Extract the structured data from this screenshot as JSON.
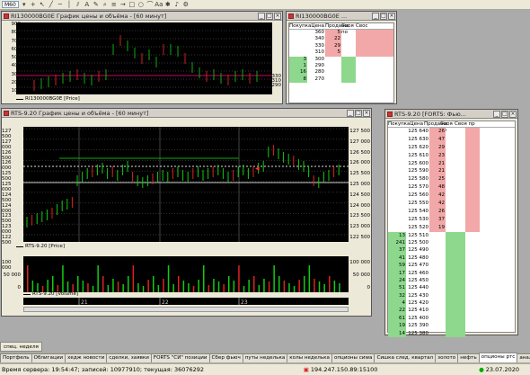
{
  "toolbar": {
    "timeframe": "M60"
  },
  "win1": {
    "title": "RI130000BG0E График цены и объёма - [60 минут]",
    "y_labels": [
      "900",
      "800",
      "700",
      "600",
      "500",
      "400",
      "300",
      "200",
      "100"
    ],
    "r_labels": [
      "330",
      "310",
      "290"
    ],
    "legend": "RI130000BG0E [Price]"
  },
  "win2": {
    "title": "RI130000BG0E ...",
    "headers": [
      "Покупка",
      "Цена",
      "Продажа",
      "Своя по",
      "Свос"
    ],
    "sells": [
      [
        "",
        "360",
        "5"
      ],
      [
        "",
        "340",
        "22"
      ],
      [
        "",
        "330",
        "29"
      ],
      [
        "",
        "310",
        "5"
      ]
    ],
    "buys": [
      [
        "3",
        "300",
        ""
      ],
      [
        "1",
        "290",
        ""
      ],
      [
        "16",
        "280",
        ""
      ],
      [
        "8",
        "270",
        ""
      ]
    ]
  },
  "win3": {
    "title": "RTS-9.20 График цены и объёма - [60 минут]",
    "price_labels": [
      "127 500",
      "127 000",
      "126 500",
      "126 000",
      "125 500",
      "125 000",
      "124 500",
      "124 000",
      "123 500",
      "123 000",
      "122 500"
    ],
    "cur_price": "125 630",
    "legend1": "RTS-9.20 [Price]",
    "vol_labels": [
      "100 000",
      "50 000",
      "0"
    ],
    "legend2": "RTS-9.20 [Volume]",
    "dates": [
      "21",
      "22",
      "23"
    ]
  },
  "win4": {
    "title": "RTS-9.20 [FORTS: Фью...",
    "headers": [
      "Покупка",
      "Цена",
      "Продажа",
      "Своя по",
      "Своя пр"
    ],
    "sells": [
      [
        "125 640",
        "26"
      ],
      [
        "125 630",
        "47"
      ],
      [
        "125 620",
        "29"
      ],
      [
        "125 610",
        "23"
      ],
      [
        "125 600",
        "21"
      ],
      [
        "125 590",
        "21"
      ],
      [
        "125 580",
        "25"
      ],
      [
        "125 570",
        "48"
      ],
      [
        "125 560",
        "42"
      ],
      [
        "125 550",
        "42"
      ],
      [
        "125 540",
        "26"
      ],
      [
        "125 530",
        "37"
      ],
      [
        "125 520",
        "19"
      ]
    ],
    "buys": [
      [
        "13",
        "125 510"
      ],
      [
        "241",
        "125 500"
      ],
      [
        "37",
        "125 490"
      ],
      [
        "41",
        "125 480"
      ],
      [
        "59",
        "125 470"
      ],
      [
        "17",
        "125 460"
      ],
      [
        "24",
        "125 450"
      ],
      [
        "51",
        "125 440"
      ],
      [
        "32",
        "125 430"
      ],
      [
        "4",
        "125 420"
      ],
      [
        "22",
        "125 410"
      ],
      [
        "61",
        "125 400"
      ],
      [
        "19",
        "125 390"
      ],
      [
        "14",
        "125 380"
      ]
    ]
  },
  "bottom_tab": "спец. неделя",
  "tabs": [
    "Портфель",
    "Облигации",
    "хедж новости",
    "сделки, заявки",
    "FORTS \"СИ\" позиции",
    "Сбер фьюч",
    "путы неделька",
    "колы неделька",
    "опционы сиwa",
    "Сишка след. квартал",
    "золото",
    "нефть",
    "опционы ртс",
    "анализ"
  ],
  "status": {
    "server_time": "Время сервера: 19:54:47; записей: 10977910; текущая: 36076292",
    "ip": "194.247.150.89:15100",
    "date": "23.07.2020"
  }
}
